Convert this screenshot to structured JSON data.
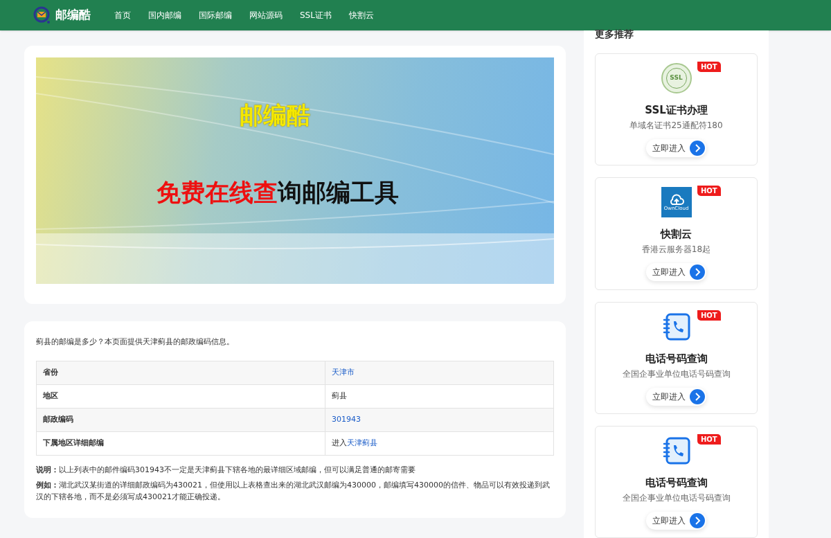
{
  "header": {
    "logo_text": "邮编酷",
    "nav": [
      {
        "label": "首页"
      },
      {
        "label": "国内邮编"
      },
      {
        "label": "国际邮编"
      },
      {
        "label": "网站源码"
      },
      {
        "label": "SSL证书"
      },
      {
        "label": "快割云"
      }
    ]
  },
  "banner": {
    "title": "邮编酷",
    "headline_red": "免费在线查",
    "headline_dark": "询邮编工具"
  },
  "intro": "蓟县的邮编是多少？本页面提供天津蓟县的邮政编码信息。",
  "table": {
    "rows": [
      {
        "label": "省份",
        "kind": "link",
        "value": "天津市"
      },
      {
        "label": "地区",
        "kind": "text",
        "value": "蓟县"
      },
      {
        "label": "邮政编码",
        "kind": "link",
        "value": "301943"
      },
      {
        "label": "下属地区详细邮编",
        "kind": "prefixed_link",
        "prefix": "进入",
        "value": "天津蓟县"
      }
    ]
  },
  "notes": [
    "**说明：**以上列表中的邮件编码301943不一定是天津蓟县下辖各地的最详细区域邮编，但可以满足普通的邮寄需要",
    "**例如：**湖北武汉某街道的详细邮政编码为430021，但使用以上表格查出来的湖北武汉邮编为430000，邮编填写430000的信件、物品可以有效投递到武汉的下辖各地，而不是必须写成430021才能正确投递。"
  ],
  "sidebar": {
    "title": "更多推荐",
    "cards": [
      {
        "kind": "ssl",
        "badge": "HOT",
        "title": "SSL证书办理",
        "subtitle": "单域名证书25通配符180",
        "button": "立即进入",
        "icon_text": "SSL"
      },
      {
        "kind": "cloud",
        "badge": "HOT",
        "title": "快割云",
        "subtitle": "香港云服务器18起",
        "button": "立即进入",
        "icon_text": "OwnCloud"
      },
      {
        "kind": "phone",
        "badge": "HOT",
        "title": "电话号码查询",
        "subtitle": "全国企事业单位电话号码查询",
        "button": "立即进入"
      },
      {
        "kind": "phone",
        "badge": "HOT",
        "title": "电话号码查询",
        "subtitle": "全国企事业单位电话号码查询",
        "button": "立即进入"
      }
    ]
  }
}
